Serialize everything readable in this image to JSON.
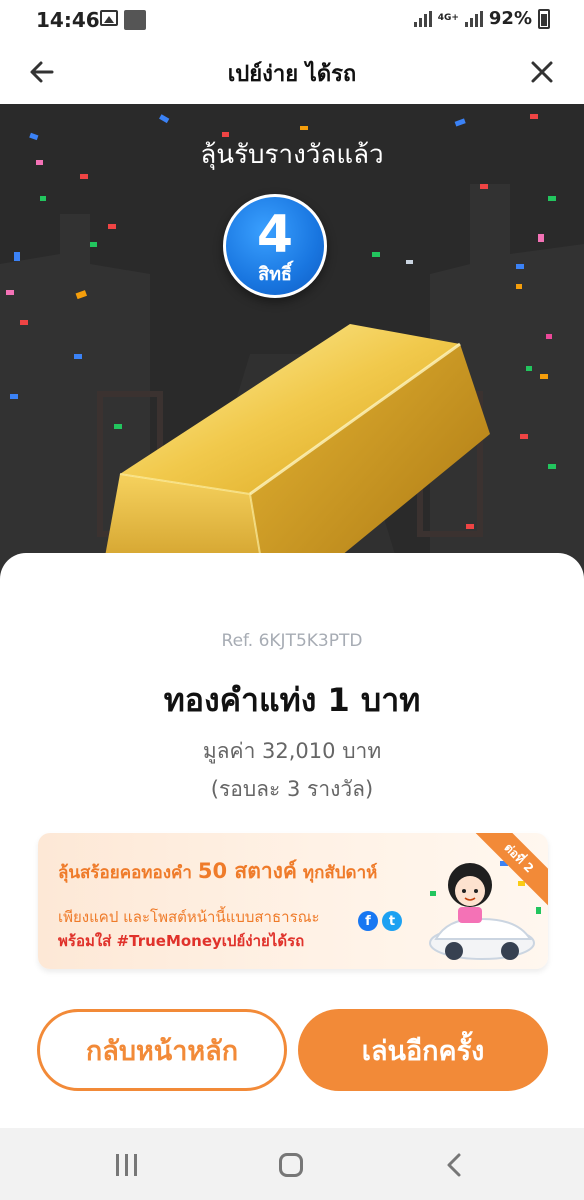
{
  "status_bar": {
    "time": "14:46",
    "network": "4G+",
    "battery": "92%"
  },
  "header": {
    "title": "เปย์ง่าย ได้รถ",
    "back_icon": "arrow-left-icon",
    "close_icon": "close-icon"
  },
  "hero": {
    "title": "ลุ้นรับรางวัลแล้ว",
    "rights_count": "4",
    "rights_label": "สิทธิ์"
  },
  "prize": {
    "ref": "Ref. 6KJT5K3PTD",
    "name": "ทองคำแท่ง 1 บาท",
    "value": "มูลค่า 32,010 บาท",
    "note": "(รอบละ 3 รางวัล)"
  },
  "promo": {
    "line1_prefix": "ลุ้นสร้อยคอทองคำ ",
    "line1_highlight": "50 สตางค์",
    "line1_suffix": " ทุกสัปดาห์",
    "line2": "เพียงแคป และโพสต์หน้านี้แบบสาธารณะ",
    "line3": "พร้อมใส่ #TrueMoneyเปย์ง่ายได้รถ",
    "ribbon": "ต่อที่ 2",
    "social_icons": [
      "facebook-icon",
      "twitter-icon"
    ]
  },
  "buttons": {
    "home": "กลับหน้าหลัก",
    "play_again": "เล่นอีกครั้ง"
  },
  "colors": {
    "accent": "#f28a38",
    "badge_blue": "#1976e0",
    "promo_red": "#e0322b"
  }
}
